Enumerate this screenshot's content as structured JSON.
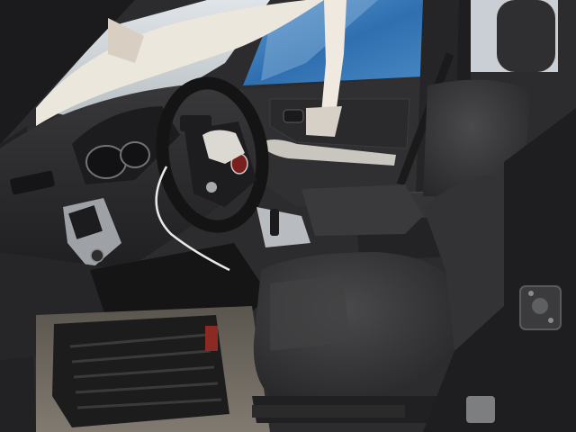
{
  "image": {
    "subject": "vehicle-front-interior-photo",
    "palette": {
      "window_sky": "#cfd6dc",
      "blue_tarp": "#3f7fbf",
      "dash": "#2a2a2c",
      "seat_fabric": "#3a3a3c",
      "seat_shadow": "#232325",
      "deployed_airbag": "#ece7dd",
      "trim_silver": "#b9bcc0",
      "floor_mat": "#1c1c1d",
      "floor": "#6b655c"
    }
  }
}
